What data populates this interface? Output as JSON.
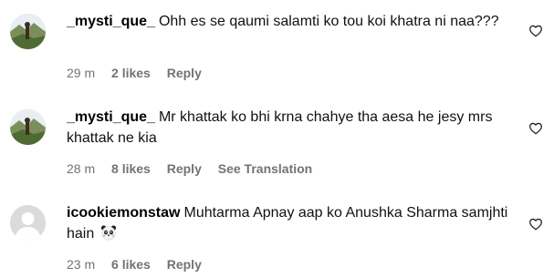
{
  "comments": [
    {
      "username": "_mysti_que_",
      "text": "Ohh es se qaumi salamti ko tou koi khatra ni naa???",
      "time": "29 m",
      "likes": "2 likes",
      "reply": "Reply",
      "translation": "",
      "avatar": "landscape-avatar"
    },
    {
      "username": "_mysti_que_",
      "text": "Mr khattak ko bhi krna chahye tha aesa he jesy mrs khattak ne kia",
      "time": "28 m",
      "likes": "8 likes",
      "reply": "Reply",
      "translation": "See Translation",
      "avatar": "landscape-avatar"
    },
    {
      "username": "icookiemonstaw",
      "text": "Muhtarma Apnay aap ko Anushka Sharma samjhti hain",
      "emoji": "panda-face",
      "time": "23 m",
      "likes": "6 likes",
      "reply": "Reply",
      "translation": "",
      "avatar": "default-avatar"
    }
  ],
  "colors": {
    "meta": "#737373",
    "text": "#111111",
    "default_avatar_bg": "#dbdbdb",
    "default_avatar_fg": "#ffffff"
  },
  "icons": {
    "like": "heart-outline-icon"
  }
}
